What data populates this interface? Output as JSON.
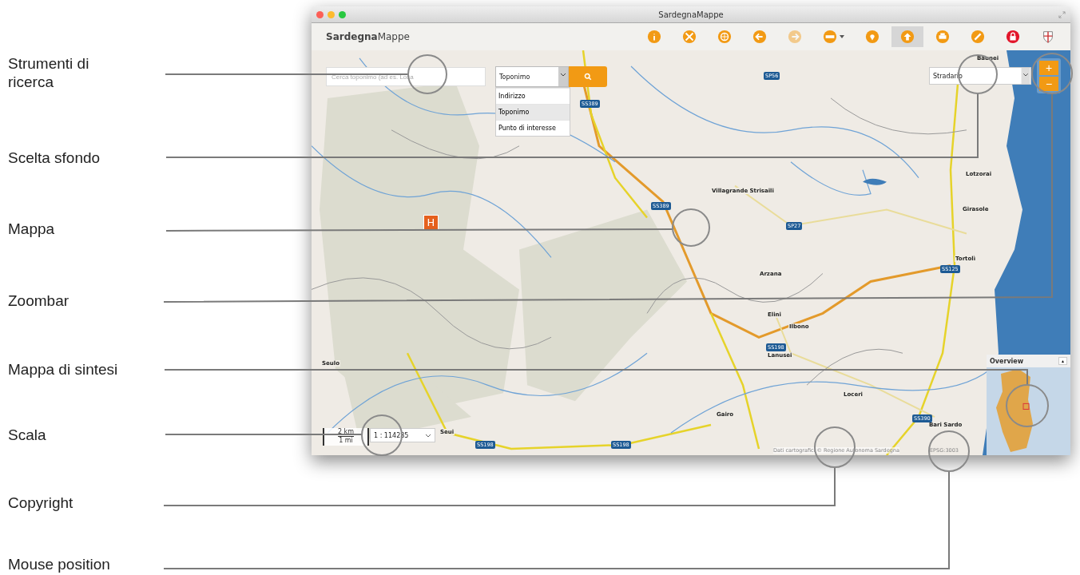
{
  "annotations": [
    {
      "label": "Strumenti di ricerca"
    },
    {
      "label": "Scelta sfondo"
    },
    {
      "label": "Mappa"
    },
    {
      "label": "Zoombar"
    },
    {
      "label": "Mappa di sintesi"
    },
    {
      "label": "Scala"
    },
    {
      "label": "Copyright"
    },
    {
      "label": "Mouse position"
    }
  ],
  "window": {
    "title": "SardegnaMappe"
  },
  "app": {
    "logo": "**Sardegna**Mappe"
  },
  "toolbar": [
    {
      "selected": false,
      "disabled": false
    },
    {
      "selected": false,
      "disabled": false
    },
    {
      "selected": false,
      "disabled": false
    },
    {
      "selected": false,
      "disabled": false
    },
    {
      "selected": false,
      "disabled": true
    },
    {
      "selected": false,
      "disabled": false,
      "has_menu": true
    },
    {
      "selected": false,
      "disabled": false
    },
    {
      "selected": true,
      "disabled": false
    },
    {
      "selected": false,
      "disabled": false
    },
    {
      "selected": false,
      "disabled": false
    },
    {
      "selected": false,
      "disabled": false
    },
    {
      "selected": false,
      "disabled": false
    }
  ],
  "search": {
    "placeholder": "Cerca toponimo (ad es. Losa",
    "type": "Toponimo",
    "expanded": true,
    "options": [
      {
        "label": "Indirizzo",
        "selected": false
      },
      {
        "label": "Toponimo",
        "selected": true
      },
      {
        "label": "Punto di interesse",
        "selected": false
      }
    ]
  },
  "basemap": {
    "value": "Stradario"
  },
  "zoombar": {
    "zoom_in": "+",
    "zoom_out": "−"
  },
  "map": {
    "places": [
      {
        "name": "Baunei"
      },
      {
        "name": "Lotzorai"
      },
      {
        "name": "Villagrande Strisaili"
      },
      {
        "name": "Girasole"
      },
      {
        "name": "Tortolì"
      },
      {
        "name": "Arzana"
      },
      {
        "name": "Elini"
      },
      {
        "name": "Ilbono"
      },
      {
        "name": "Lanusei"
      },
      {
        "name": "Seulo"
      },
      {
        "name": "Loceri"
      },
      {
        "name": "Gairo"
      },
      {
        "name": "Bari Sardo"
      },
      {
        "name": "Seui"
      }
    ],
    "road_shields": [
      {
        "label": "SP56"
      },
      {
        "label": "SS389"
      },
      {
        "label": "SS389"
      },
      {
        "label": "SP27"
      },
      {
        "label": "SS125"
      },
      {
        "label": "SS198"
      },
      {
        "label": "SS198"
      },
      {
        "label": "SS198"
      },
      {
        "label": "SS390"
      }
    ],
    "marker": {
      "label": "H"
    }
  },
  "overview": {
    "title": "Overview",
    "toggle": "▲"
  },
  "scale": {
    "km": "2 km",
    "mi": "1 mi",
    "ratio": "1 : 114285"
  },
  "copyright": "Dati cartografici © Regione Autonoma Sardegna",
  "mouse_position": "EPSG:3003"
}
